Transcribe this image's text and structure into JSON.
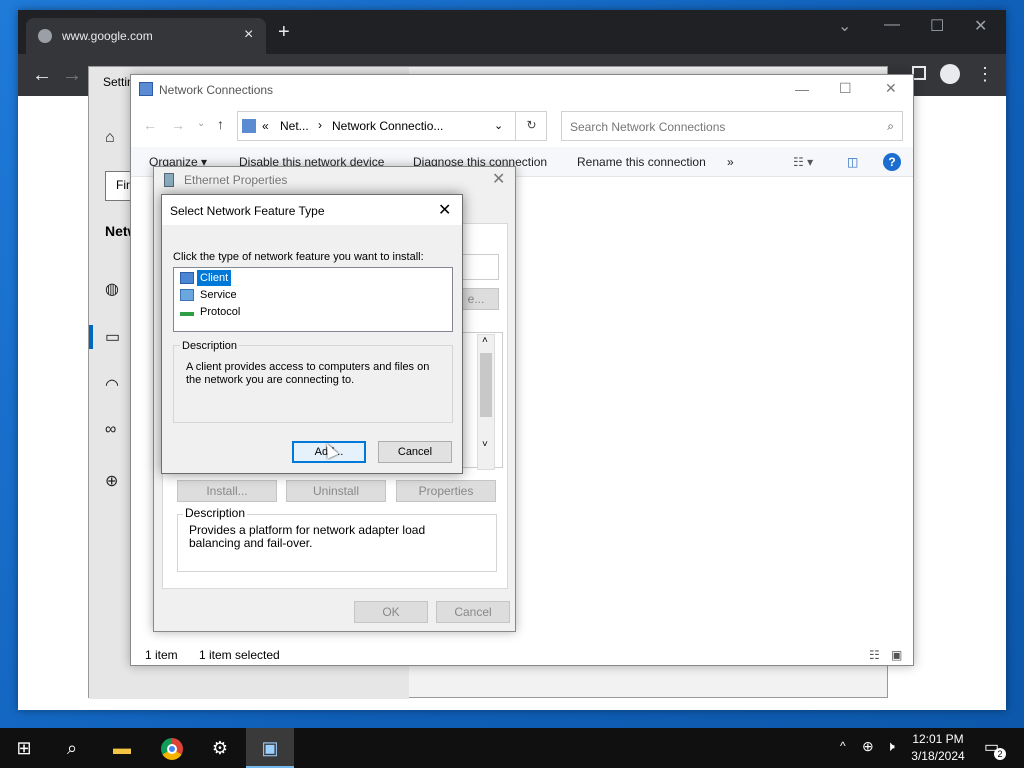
{
  "chrome": {
    "tab_title": "www.google.com",
    "new_tab": "+",
    "tab_close": "×",
    "minimize": "⌄",
    "restore": "☐",
    "close": "✕",
    "back": "←",
    "forward": "→",
    "menu": "⋮"
  },
  "settings": {
    "title": "Settin",
    "find_placeholder": "Fin",
    "section": "Netw"
  },
  "netconn": {
    "title": "Network Connections",
    "breadcrumb_prefix": "«",
    "breadcrumb_1": "Net...",
    "breadcrumb_sep": "›",
    "breadcrumb_2": "Network Connectio...",
    "search_placeholder": "Search Network Connections",
    "commands": [
      "Organize ▾",
      "Disable this network device",
      "Diagnose this connection",
      "Rename this connection",
      "»"
    ],
    "status_count": "1 item",
    "status_selected": "1 item selected",
    "minimize": "—",
    "maximize": "☐",
    "close": "✕"
  },
  "ethernet": {
    "title": "Ethernet Properties",
    "close": "✕",
    "install_label": "Install...",
    "uninstall_label": "Uninstall",
    "properties_label": "Properties",
    "description_label": "Description",
    "description_text": "Provides a platform for network adapter load balancing and fail-over.",
    "ok_label": "OK",
    "cancel_label": "Cancel",
    "configure_label": "e..."
  },
  "select_feature": {
    "title": "Select Network Feature Type",
    "close": "✕",
    "prompt": "Click the type of network feature you want to install:",
    "items": [
      {
        "label": "Client",
        "selected": true,
        "icon": "client-icon"
      },
      {
        "label": "Service",
        "selected": false,
        "icon": "service-icon"
      },
      {
        "label": "Protocol",
        "selected": false,
        "icon": "protocol-icon"
      }
    ],
    "description_label": "Description",
    "description_text": "A client provides access to computers and files on the network you are connecting to.",
    "add_label": "Add...",
    "cancel_label": "Cancel"
  },
  "taskbar": {
    "time": "12:01 PM",
    "date": "3/18/2024",
    "notification_count": "2"
  },
  "colors": {
    "selection": "#0078d7",
    "taskbar": "#101010",
    "desktop": "#1a6fc9"
  }
}
